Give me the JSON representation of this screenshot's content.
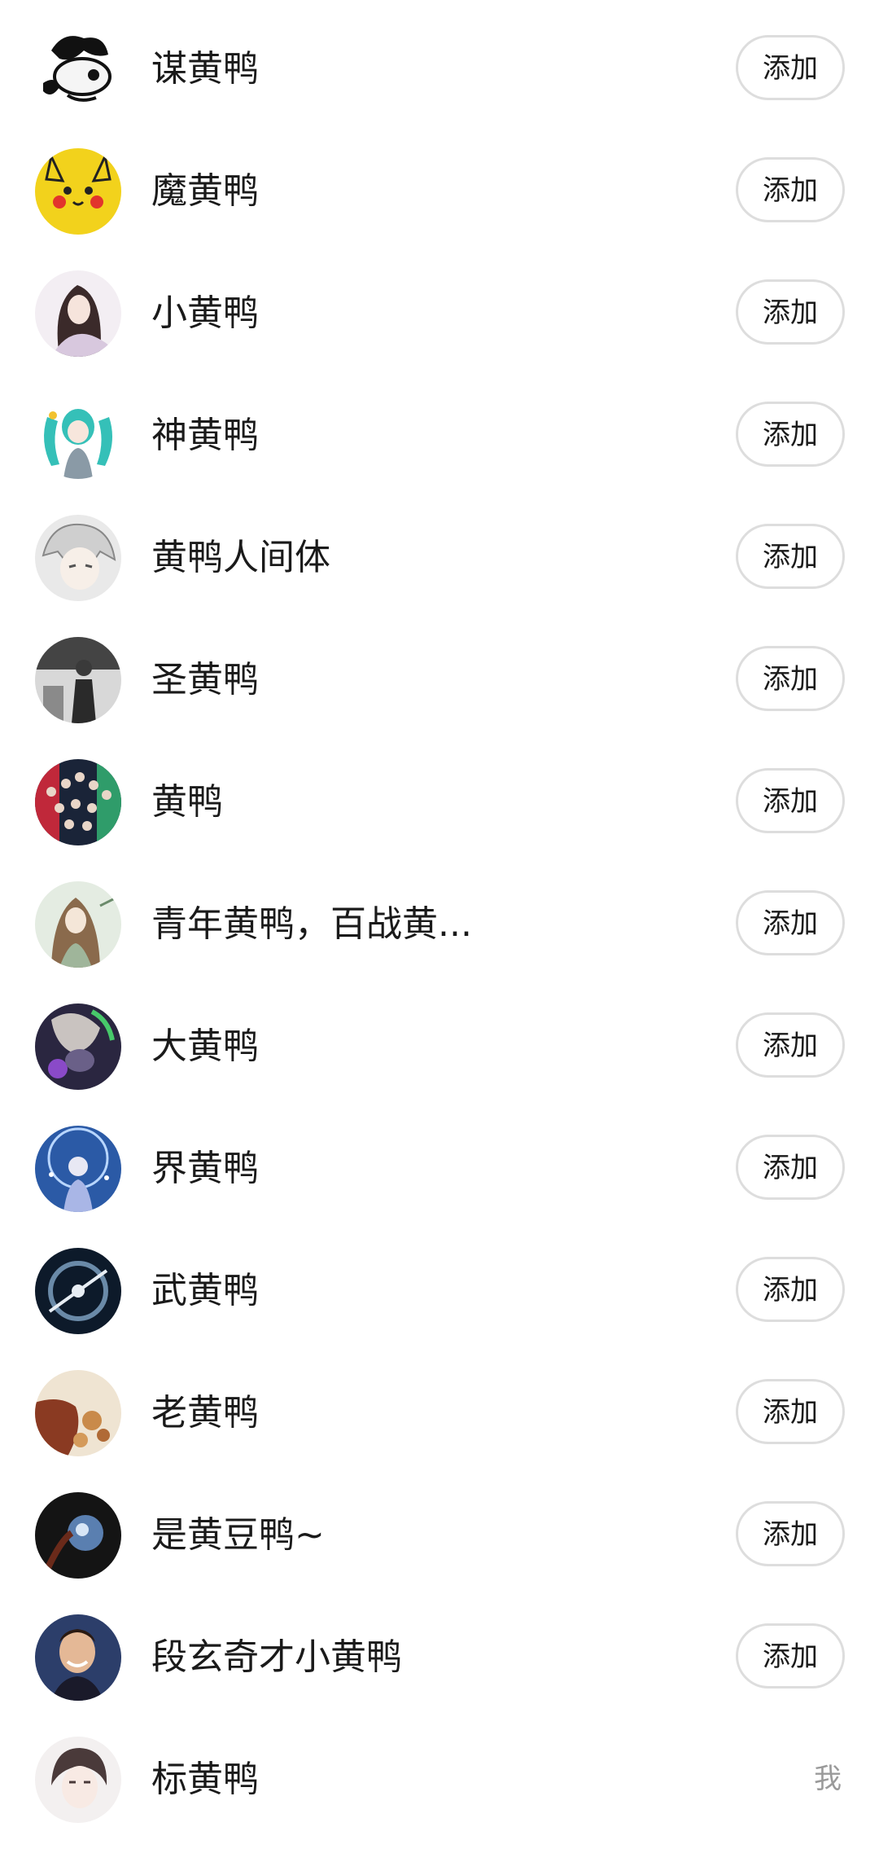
{
  "contacts": [
    {
      "name": "谋黄鸭",
      "action": "添加"
    },
    {
      "name": "魔黄鸭",
      "action": "添加"
    },
    {
      "name": "小黄鸭",
      "action": "添加"
    },
    {
      "name": "神黄鸭",
      "action": "添加"
    },
    {
      "name": "黄鸭人间体",
      "action": "添加"
    },
    {
      "name": "圣黄鸭",
      "action": "添加"
    },
    {
      "name": "黄鸭",
      "action": "添加"
    },
    {
      "name": "青年黄鸭，百战黄...",
      "action": "添加"
    },
    {
      "name": "大黄鸭",
      "action": "添加"
    },
    {
      "name": "界黄鸭",
      "action": "添加"
    },
    {
      "name": "武黄鸭",
      "action": "添加"
    },
    {
      "name": "老黄鸭",
      "action": "添加"
    },
    {
      "name": "是黄豆鸭~",
      "action": "添加"
    },
    {
      "name": "段玄奇才小黄鸭",
      "action": "添加"
    }
  ],
  "self": {
    "name": "标黄鸭",
    "label": "我"
  }
}
